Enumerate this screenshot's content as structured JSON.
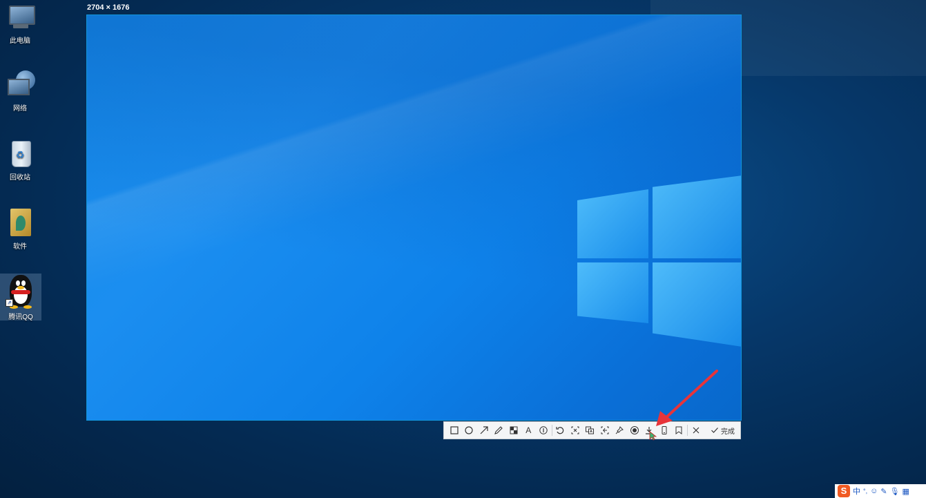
{
  "desktop": {
    "icons": [
      {
        "label": "此电脑",
        "icon": "computer-icon"
      },
      {
        "label": "网络",
        "icon": "network-icon"
      },
      {
        "label": "回收站",
        "icon": "recycle-bin-icon"
      },
      {
        "label": "软件",
        "icon": "folder-icon"
      },
      {
        "label": "腾讯QQ",
        "icon": "qq-penguin-icon"
      }
    ]
  },
  "capture": {
    "size_label": "2704 × 1676"
  },
  "toolbar": {
    "tools": [
      {
        "name": "rectangle",
        "icon": "rectangle-icon"
      },
      {
        "name": "ellipse",
        "icon": "ellipse-icon"
      },
      {
        "name": "arrow",
        "icon": "arrow-icon"
      },
      {
        "name": "pencil",
        "icon": "pencil-icon"
      },
      {
        "name": "mosaic",
        "icon": "mosaic-icon"
      },
      {
        "name": "text",
        "icon": "text-icon",
        "glyph": "A"
      },
      {
        "name": "number",
        "icon": "number-icon"
      },
      {
        "name": "undo",
        "icon": "undo-icon"
      },
      {
        "name": "ocr",
        "icon": "ocr-icon"
      },
      {
        "name": "translate",
        "icon": "translate-icon"
      },
      {
        "name": "long-screenshot",
        "icon": "scroll-capture-icon"
      },
      {
        "name": "pin",
        "icon": "pin-icon"
      },
      {
        "name": "record",
        "icon": "record-icon"
      },
      {
        "name": "download",
        "icon": "download-icon"
      },
      {
        "name": "phone",
        "icon": "phone-icon"
      },
      {
        "name": "bookmark",
        "icon": "bookmark-icon"
      },
      {
        "name": "cancel",
        "icon": "close-icon"
      }
    ],
    "done_label": "完成"
  },
  "tray": {
    "ime_lang": "中",
    "ime_punct": "°,",
    "colors": {
      "sogou": "#f05a22"
    }
  },
  "colors": {
    "desktop_bg": "#06386a",
    "capture_border": "#1296db",
    "annotation_arrow": "#e8343a"
  }
}
